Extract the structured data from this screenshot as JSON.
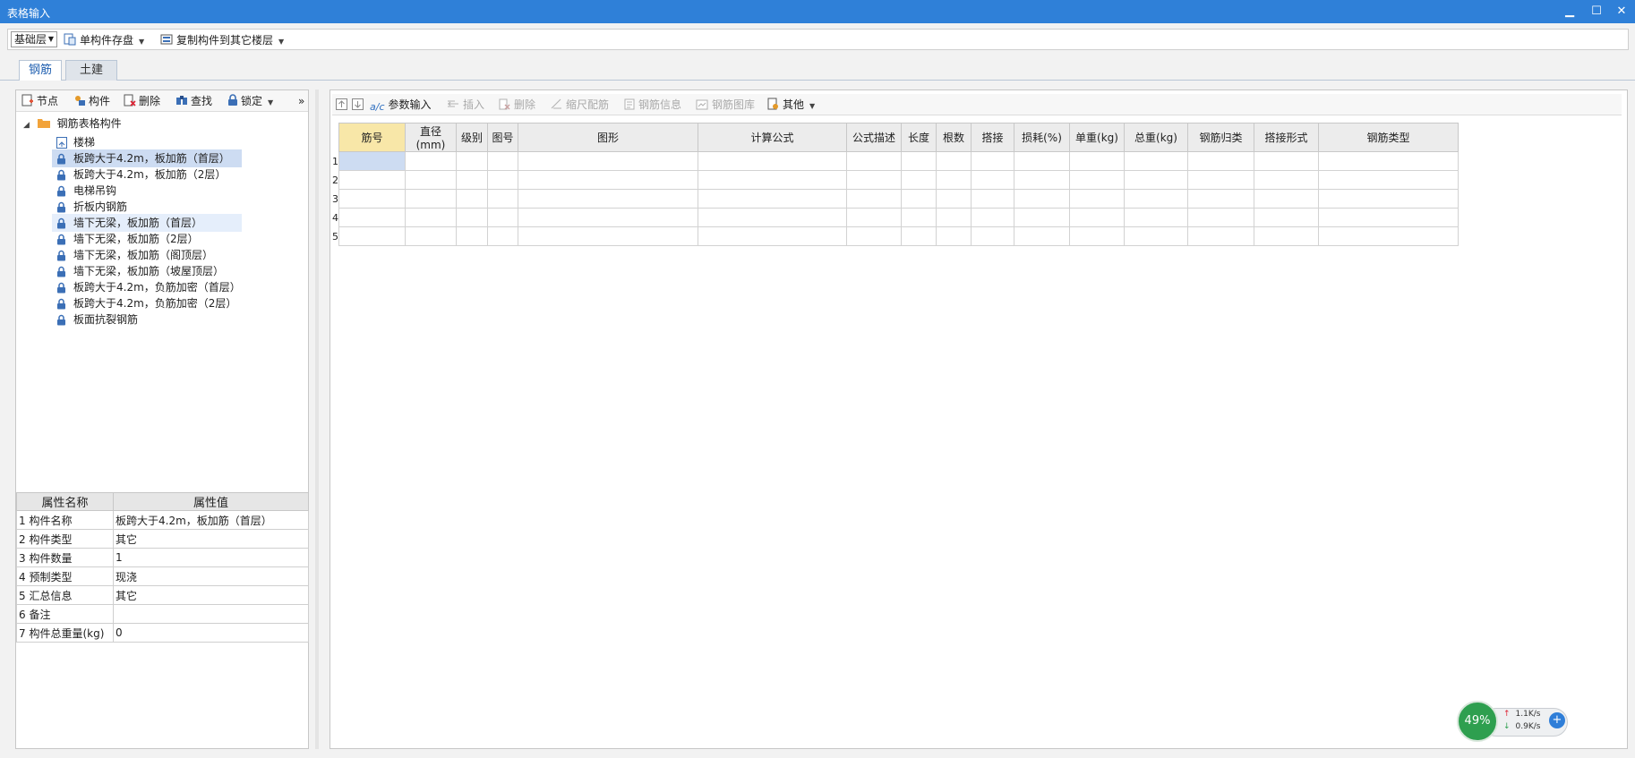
{
  "window": {
    "title": "表格输入",
    "minimize": "▁",
    "maximize": "☐",
    "close": "✕"
  },
  "toolbar": {
    "floor_select": "基础层",
    "save_component": "单构件存盘",
    "copy_to_floor": "复制构件到其它楼层"
  },
  "tabs": [
    {
      "label": "钢筋"
    },
    {
      "label": "土建"
    }
  ],
  "left_toolbar": {
    "node": "节点",
    "component": "构件",
    "delete": "删除",
    "find": "查找",
    "lock": "锁定",
    "more": "»"
  },
  "tree": {
    "root": "钢筋表格构件",
    "items": [
      {
        "label": "楼梯"
      },
      {
        "label": "板跨大于4.2m，板加筋（首层）"
      },
      {
        "label": "板跨大于4.2m，板加筋（2层）"
      },
      {
        "label": "电梯吊钩"
      },
      {
        "label": "折板内钢筋"
      },
      {
        "label": "墙下无梁，板加筋（首层）"
      },
      {
        "label": "墙下无梁，板加筋（2层）"
      },
      {
        "label": "墙下无梁，板加筋（阁顶层）"
      },
      {
        "label": "墙下无梁，板加筋（坡屋顶层）"
      },
      {
        "label": "板跨大于4.2m，负筋加密（首层）"
      },
      {
        "label": "板跨大于4.2m，负筋加密（2层）"
      },
      {
        "label": "板面抗裂钢筋"
      }
    ]
  },
  "props": {
    "headers": [
      "属性名称",
      "属性值"
    ],
    "rows": [
      {
        "num": "1",
        "name": "构件名称",
        "value": "板跨大于4.2m，板加筋（首层）"
      },
      {
        "num": "2",
        "name": "构件类型",
        "value": "其它"
      },
      {
        "num": "3",
        "name": "构件数量",
        "value": "1"
      },
      {
        "num": "4",
        "name": "预制类型",
        "value": "现浇"
      },
      {
        "num": "5",
        "name": "汇总信息",
        "value": "其它"
      },
      {
        "num": "6",
        "name": "备注",
        "value": ""
      },
      {
        "num": "7",
        "name": "构件总重量(kg)",
        "value": "0"
      }
    ]
  },
  "grid_toolbar": {
    "param_input": "参数输入",
    "insert": "插入",
    "delete": "删除",
    "scale_rebar": "缩尺配筋",
    "rebar_info": "钢筋信息",
    "rebar_library": "钢筋图库",
    "other": "其他"
  },
  "grid": {
    "headers": [
      "筋号",
      "直径(mm)",
      "级别",
      "图号",
      "图形",
      "计算公式",
      "公式描述",
      "长度",
      "根数",
      "搭接",
      "损耗(%)",
      "单重(kg)",
      "总重(kg)",
      "钢筋归类",
      "搭接形式",
      "钢筋类型"
    ],
    "row_numbers": [
      "1",
      "2",
      "3",
      "4",
      "5"
    ]
  },
  "net_widget": {
    "percent": "49%",
    "up": "1.1K/s",
    "down": "0.9K/s",
    "up_arrow": "↑",
    "down_arrow": "↓",
    "plus": "+"
  },
  "colors": {
    "titlebar": "#2f80d8",
    "selection": "#cddcf2",
    "header_active": "#f8e7a8",
    "accent_green": "#2e9f4f"
  }
}
